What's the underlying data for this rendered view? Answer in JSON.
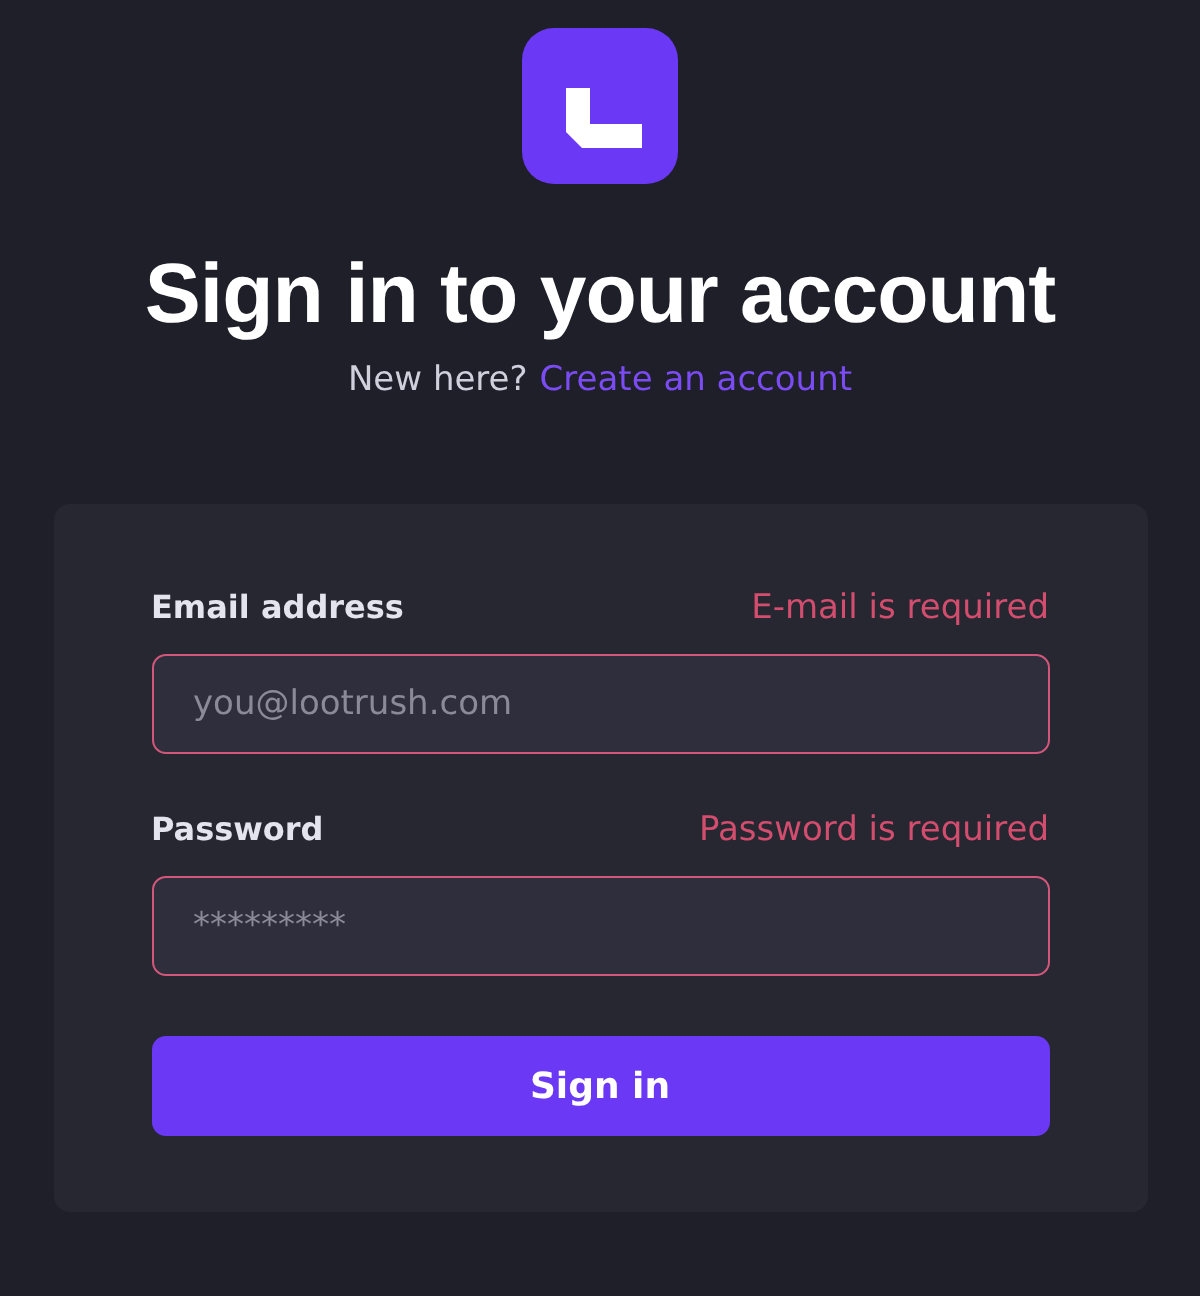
{
  "title": "Sign in to your account",
  "subtitle": {
    "text": "New here?",
    "link": "Create an account"
  },
  "fields": [
    {
      "label": "Email address",
      "error": "E-mail is required",
      "placeholder": "you@lootrush.com"
    },
    {
      "label": "Password",
      "error": "Password is required",
      "placeholder": "*********"
    }
  ],
  "submit": "Sign in"
}
